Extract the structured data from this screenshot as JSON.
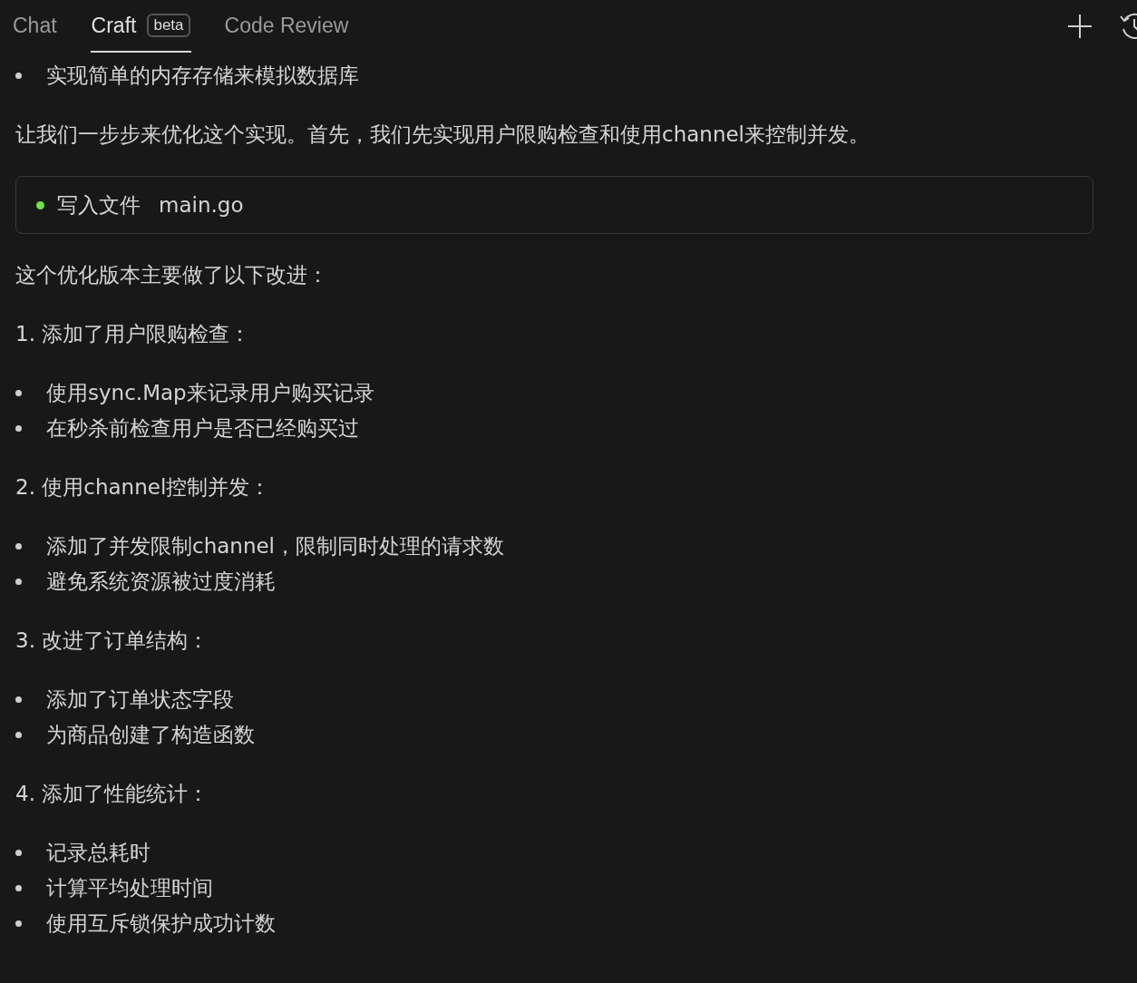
{
  "tabs": [
    {
      "label": "Chat",
      "selected": false
    },
    {
      "label": "Craft",
      "badge": "beta",
      "selected": true
    },
    {
      "label": "Code Review",
      "selected": false
    }
  ],
  "blocks": [
    {
      "kind": "bullets",
      "items": [
        "实现简单的内存存储来模拟数据库"
      ]
    },
    {
      "kind": "paragraph",
      "text": "让我们一步步来优化这个实现。首先，我们先实现用户限购检查和使用channel来控制并发。"
    },
    {
      "kind": "file",
      "done": true,
      "action": "写入文件",
      "file": "main.go"
    },
    {
      "kind": "paragraph",
      "text": "这个优化版本主要做了以下改进："
    },
    {
      "kind": "paragraph",
      "text": "1. 添加了用户限购检查："
    },
    {
      "kind": "bullets",
      "items": [
        "使用sync.Map来记录用户购买记录",
        "在秒杀前检查用户是否已经购买过"
      ]
    },
    {
      "kind": "paragraph",
      "text": "2. 使用channel控制并发："
    },
    {
      "kind": "bullets",
      "items": [
        "添加了并发限制channel，限制同时处理的请求数",
        "避免系统资源被过度消耗"
      ]
    },
    {
      "kind": "paragraph",
      "text": "3. 改进了订单结构："
    },
    {
      "kind": "bullets",
      "items": [
        "添加了订单状态字段",
        "为商品创建了构造函数"
      ]
    },
    {
      "kind": "paragraph",
      "text": "4. 添加了性能统计："
    },
    {
      "kind": "bullets",
      "items": [
        "记录总耗时",
        "计算平均处理时间",
        "使用互斥锁保护成功计数"
      ]
    }
  ]
}
